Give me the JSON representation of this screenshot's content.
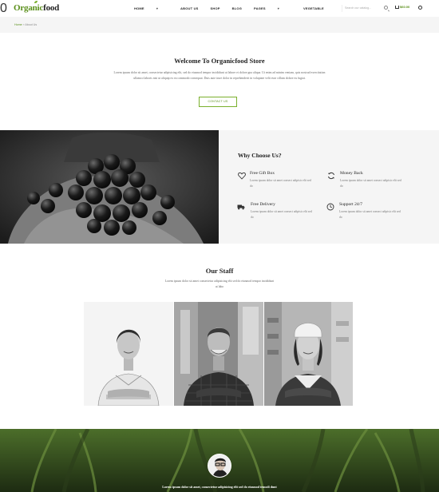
{
  "header": {
    "logo_part1": "Organic",
    "logo_part2": "food",
    "nav": [
      {
        "label": "HOME",
        "active": true,
        "has_dropdown": true
      },
      {
        "label": "ABOUT US",
        "active": false,
        "has_dropdown": false
      },
      {
        "label": "SHOP",
        "active": false,
        "has_dropdown": false
      },
      {
        "label": "BLOG",
        "active": false,
        "has_dropdown": false
      },
      {
        "label": "PAGES",
        "active": false,
        "has_dropdown": true
      },
      {
        "label": "VEGETABLE",
        "active": false,
        "has_dropdown": false
      }
    ],
    "search_placeholder": "Search our catalog...",
    "cart_total": "$60.00",
    "cart_count": "0"
  },
  "breadcrumb": {
    "home": "Home",
    "separator": "»",
    "current": "About Us"
  },
  "welcome": {
    "title": "Welcome To Organicfood Store",
    "text": "Lorem ipsum dolor sit amet, consectetur adipisicing elit, sed do eiusmod tempor incididunt ut labore et dolore gna aliqua. Ut enim ad minim veniam, quis nostrud exercitation ullamco laboris nisi ut aliquip ex ea commodo consequat. Duis aute irure dolor in reprehenderit in voluptate velit esse cillum dolore eu fugiat.",
    "button": "CONTACT US"
  },
  "why": {
    "title": "Why Choose Us?",
    "features": [
      {
        "title": "Free Gift Box",
        "text": "Lorem ipsum dolor sit amet consect adipisic elit sed do",
        "icon": "heart-icon"
      },
      {
        "title": "Money Back",
        "text": "Lorem ipsum dolor sit amet consect adipisic elit sed do",
        "icon": "refresh-icon"
      },
      {
        "title": "Free Delivery",
        "text": "Lorem ipsum dolor sit amet consect adipisic elit sed do",
        "icon": "truck-icon"
      },
      {
        "title": "Support 24/7",
        "text": "Lorem ipsum dolor sit amet consect adipisic elit sed do",
        "icon": "clock-icon"
      }
    ]
  },
  "staff": {
    "title": "Our Staff",
    "text": "Lorem ipsum dolor sit amet consectetur adipisicing elit sed do eiusmod tempor incididunt ut labo"
  },
  "testimonial": {
    "text": "Lorem ipsum dolor sit amet, consectetur adipisicing elit sed do eiusmod temodi dunt"
  },
  "colors": {
    "accent": "#5a8f1a",
    "panel_bg": "#f5f5f5",
    "title": "#222222"
  }
}
